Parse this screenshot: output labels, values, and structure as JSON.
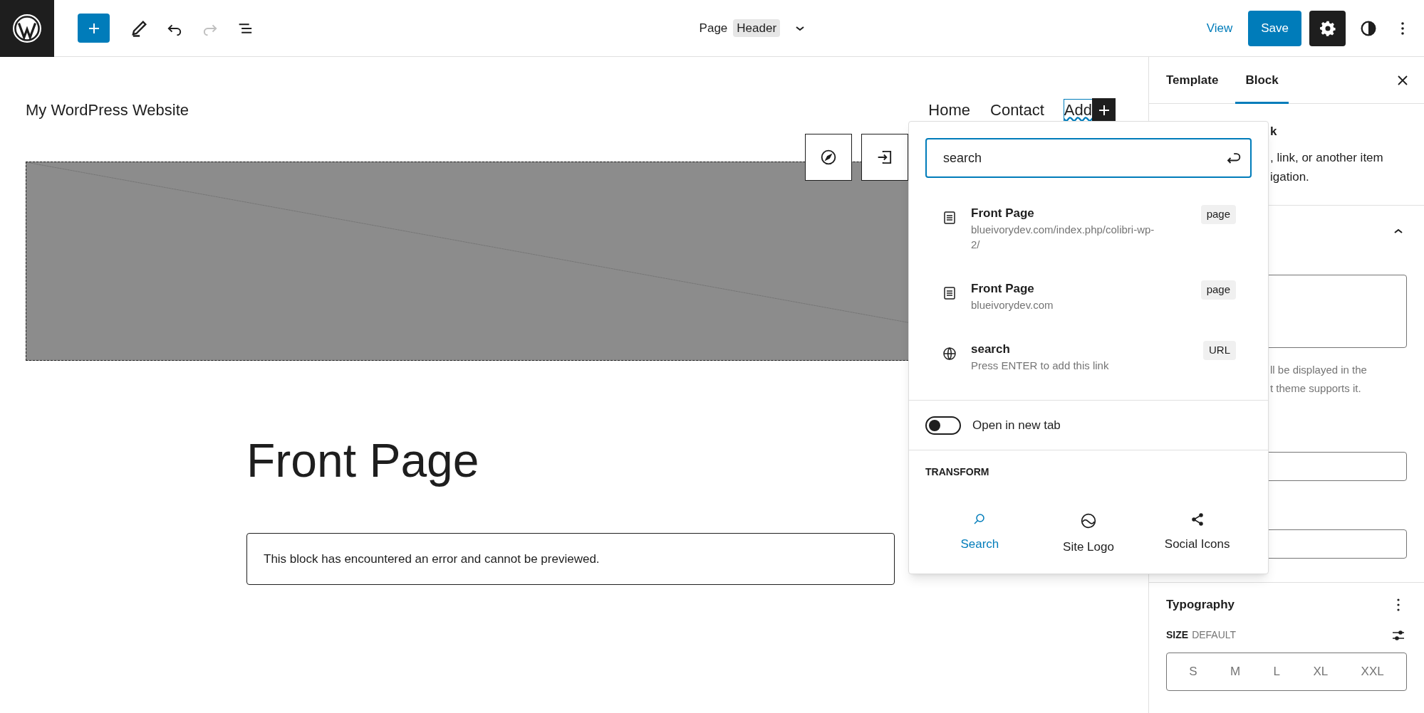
{
  "toolbar": {
    "page_label": "Page",
    "template_chip": "Header",
    "view": "View",
    "save": "Save",
    "settings_active": true
  },
  "canvas": {
    "site_title": "My WordPress Website",
    "nav": [
      {
        "label": "Home",
        "kind": "link"
      },
      {
        "label": "Contact",
        "kind": "link"
      },
      {
        "label": "Add",
        "kind": "editing"
      }
    ],
    "heading": "Front Page",
    "error": "This block has encountered an error and cannot be previewed."
  },
  "link_popover": {
    "search_value": "search",
    "results": [
      {
        "title": "Front Page",
        "url": "blueivorydev.com/index.php/colibri-wp-2/",
        "tag": "page",
        "kind": "page"
      },
      {
        "title": "Front Page",
        "url": "blueivorydev.com",
        "tag": "page",
        "kind": "page"
      },
      {
        "title": "search",
        "url": "Press ENTER to add this link",
        "tag": "URL",
        "kind": "url"
      }
    ],
    "open_in_new_tab": {
      "label": "Open in new tab",
      "on": false
    },
    "transform_label": "TRANSFORM",
    "transforms": [
      {
        "label": "Search",
        "kind": "search",
        "selected": true
      },
      {
        "label": "Site Logo",
        "kind": "logo",
        "selected": false
      },
      {
        "label": "Social Icons",
        "kind": "social",
        "selected": false
      }
    ]
  },
  "sidebar": {
    "tabs": [
      {
        "label": "Template",
        "selected": false
      },
      {
        "label": "Block",
        "selected": true
      }
    ],
    "description_fragments": [
      "k",
      ", link, or another item",
      "igation."
    ],
    "help_fragments": [
      "ll be displayed in the",
      "t theme supports it."
    ],
    "typography": {
      "title": "Typography",
      "size_label": "SIZE",
      "size_value": "DEFAULT",
      "sizes": [
        "S",
        "M",
        "L",
        "XL",
        "XXL"
      ]
    }
  }
}
